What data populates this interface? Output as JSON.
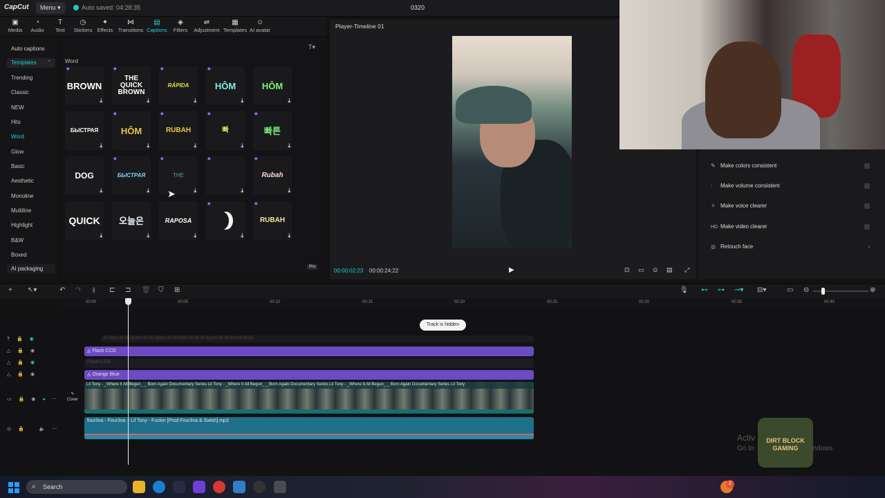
{
  "app": {
    "logo": "CapCut",
    "menu_label": "Menu",
    "autosave": "Auto saved: 04:28:35",
    "project_title": "0320"
  },
  "toolbar": [
    {
      "label": "Media",
      "icon": "media-icon"
    },
    {
      "label": "Audio",
      "icon": "audio-icon"
    },
    {
      "label": "Text",
      "icon": "text-icon"
    },
    {
      "label": "Stickers",
      "icon": "stickers-icon"
    },
    {
      "label": "Effects",
      "icon": "effects-icon"
    },
    {
      "label": "Transitions",
      "icon": "transitions-icon"
    },
    {
      "label": "Captions",
      "icon": "captions-icon",
      "active": true
    },
    {
      "label": "Filters",
      "icon": "filters-icon"
    },
    {
      "label": "Adjustment",
      "icon": "adjustment-icon"
    },
    {
      "label": "Templates",
      "icon": "templates-icon"
    },
    {
      "label": "AI avatar",
      "icon": "ai-avatar-icon"
    }
  ],
  "leftnav": {
    "auto_captions": "Auto captions",
    "templates": "Templates",
    "items": [
      "Trending",
      "Classic",
      "NEW",
      "Hits",
      "Word",
      "Glow",
      "Basic",
      "Aesthetic",
      "Monoline",
      "Multiline",
      "Highlight",
      "B&W",
      "Boxed"
    ],
    "selected": "Word",
    "ai_packaging": "AI packaging"
  },
  "grid": {
    "section": "Word",
    "cards": [
      "BROWN",
      "THE QUICK BROWN",
      "RÁPIDA",
      "HÔM",
      "HÔM",
      "БЫСТРАЯ",
      "HÔM",
      "RUBAH",
      "빠",
      "빠른",
      "DOG",
      "БЫСТРАЯ",
      "THE",
      "",
      "Rubah",
      "QUICK",
      "오늘은",
      "RAPOSA",
      "",
      "RUBAH"
    ],
    "pro_badge": "Pro"
  },
  "player": {
    "title": "Player-Timeline 01",
    "time_current": "00:00:02:23",
    "time_total": "00:00:24:22"
  },
  "enhance": [
    {
      "label": "Make colors consistent",
      "icon": "palette-icon"
    },
    {
      "label": "Make volume consistent",
      "icon": "volume-bars-icon"
    },
    {
      "label": "Make voice clearer",
      "icon": "sparkle-icon"
    },
    {
      "label": "Make video clearer",
      "icon": "hd-icon",
      "icon_text": "HD"
    },
    {
      "label": "Retouch face",
      "icon": "face-icon"
    }
  ],
  "timeline": {
    "ruler": [
      "00:00",
      "00:05",
      "00:10",
      "00:15",
      "00:20",
      "00:25",
      "00:30",
      "00:35",
      "00:40"
    ],
    "track_hidden_tip": "Track is hidden",
    "clip_text": "All Slats All  All Sports  All  All Sports  All  All Slats  All  All  All Sports  All  All Sports  All  All",
    "clip_flash": "Flash CCD",
    "clip_hidden": "Flash CCD",
    "clip_orange": "Orange Blue",
    "clip_video": "Lil Tony - _Where It All Begun_ _ Born Again Documentary Series   Lil Tony - _Where It All Begun_ _ Born Again Documentary Series   Lil Tony - _Where It All Begun_ _ Born Again Documentary Series   Lil Tony",
    "cover": "Cover",
    "clip_audio": "four3va - Four3va + Lil Tony - Fuckin [Prod Four3va & Swish].mp3"
  },
  "watermark": {
    "line1": "Activ",
    "line2": "Go to",
    "line2b": "Windows."
  },
  "overlay_logo": "DIRT BLOCK GAMING",
  "taskbar": {
    "search": "Search",
    "notification_count": "2"
  }
}
